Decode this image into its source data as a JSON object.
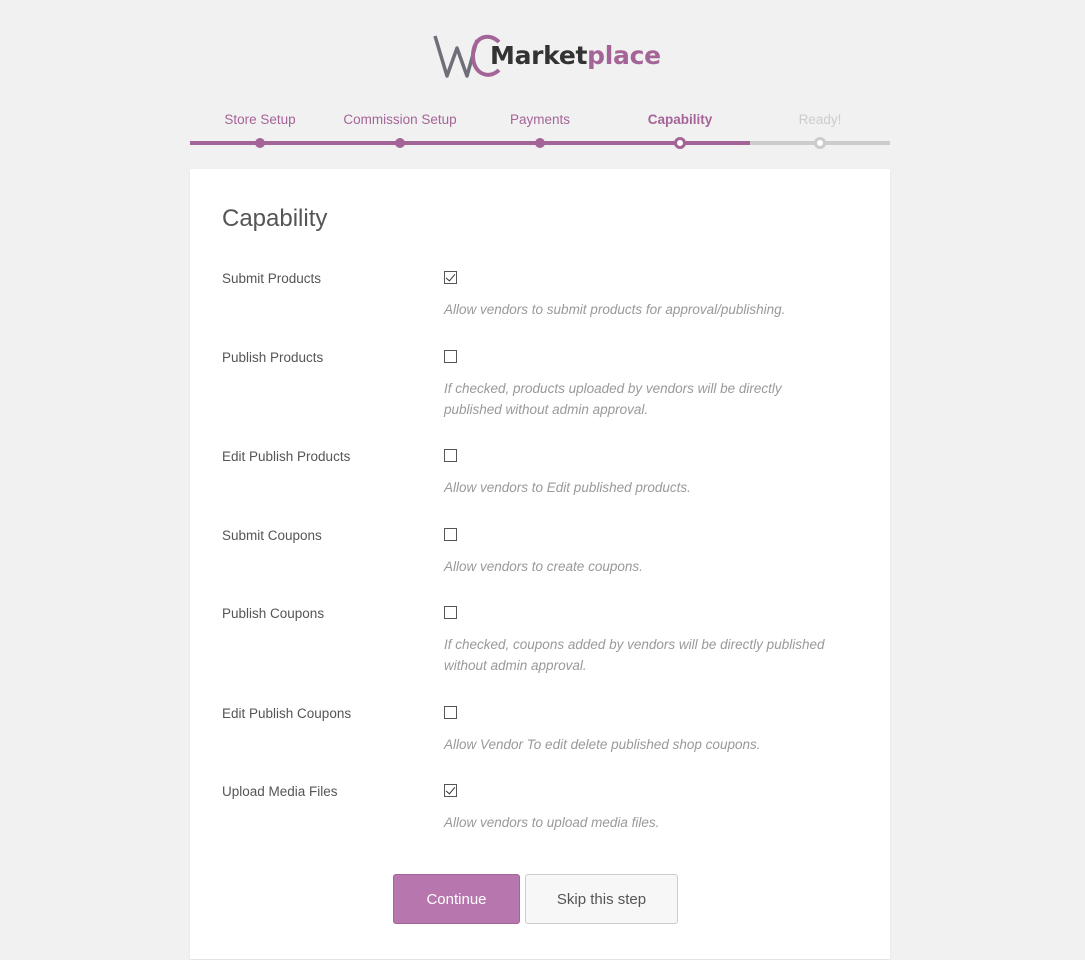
{
  "logo": {
    "prefix_letters": "WC",
    "word_dark": "Market",
    "word_accent": "place"
  },
  "steps": [
    {
      "label": "Store Setup",
      "state": "done"
    },
    {
      "label": "Commission Setup",
      "state": "done"
    },
    {
      "label": "Payments",
      "state": "done"
    },
    {
      "label": "Capability",
      "state": "active"
    },
    {
      "label": "Ready!",
      "state": "future"
    }
  ],
  "card": {
    "title": "Capability",
    "rows": [
      {
        "label": "Submit Products",
        "checked": true,
        "description": "Allow vendors to submit products for approval/publishing."
      },
      {
        "label": "Publish Products",
        "checked": false,
        "description": "If checked, products uploaded by vendors will be directly published without admin approval."
      },
      {
        "label": "Edit Publish Products",
        "checked": false,
        "description": "Allow vendors to Edit published products."
      },
      {
        "label": "Submit Coupons",
        "checked": false,
        "description": "Allow vendors to create coupons."
      },
      {
        "label": "Publish Coupons",
        "checked": false,
        "description": "If checked, coupons added by vendors will be directly published without admin approval."
      },
      {
        "label": "Edit Publish Coupons",
        "checked": false,
        "description": "Allow Vendor To edit delete published shop coupons."
      },
      {
        "label": "Upload Media Files",
        "checked": true,
        "description": "Allow vendors to upload media files."
      }
    ]
  },
  "buttons": {
    "continue": "Continue",
    "skip": "Skip this step"
  },
  "colors": {
    "accent": "#a46497",
    "button": "#b776ad",
    "inactive": "#cccccc"
  }
}
